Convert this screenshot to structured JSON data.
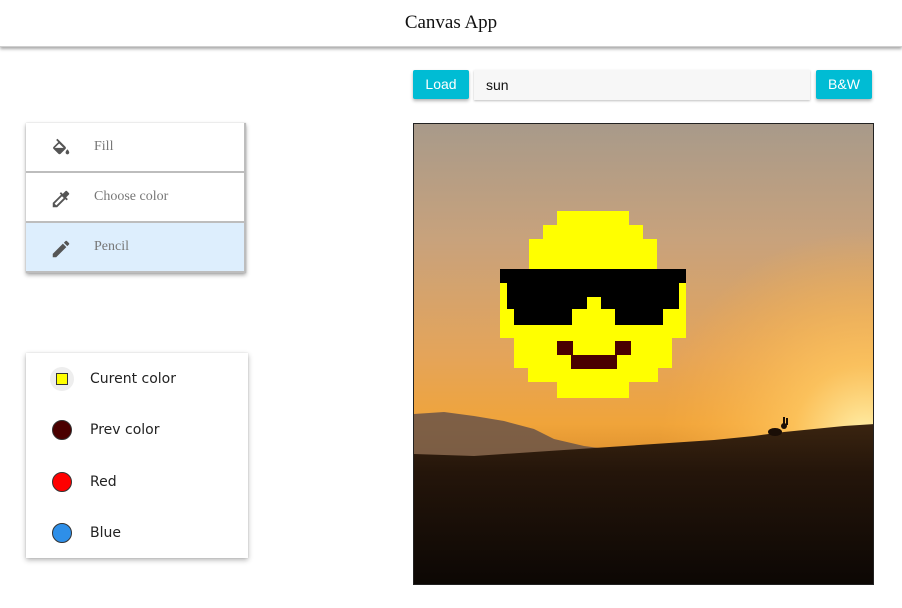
{
  "header": {
    "title": "Canvas App"
  },
  "tools": [
    {
      "name": "tool-fill",
      "icon": "paint-bucket-icon",
      "label": "Fill",
      "active": false
    },
    {
      "name": "tool-choose-color",
      "icon": "eyedropper-icon",
      "label": "Choose color",
      "active": false
    },
    {
      "name": "tool-pencil",
      "icon": "pencil-icon",
      "label": "Pencil",
      "active": true
    }
  ],
  "colors": {
    "current": {
      "label": "Curent color",
      "color": "#ffff00"
    },
    "prev": {
      "label": "Prev color",
      "color": "#4a0000"
    },
    "red": {
      "label": "Red",
      "color": "#ff0000"
    },
    "blue": {
      "label": "Blue",
      "color": "#2e8fe8"
    }
  },
  "toolbar": {
    "load_label": "Load",
    "search_value": "sun",
    "bw_label": "B&W"
  },
  "theme": {
    "accent": "#00bcd4",
    "active_tool_bg": "#ddeefd"
  },
  "canvas": {
    "background": "sunset-landscape-photo",
    "drawing": "pixel-art-sunglasses-smiley"
  }
}
